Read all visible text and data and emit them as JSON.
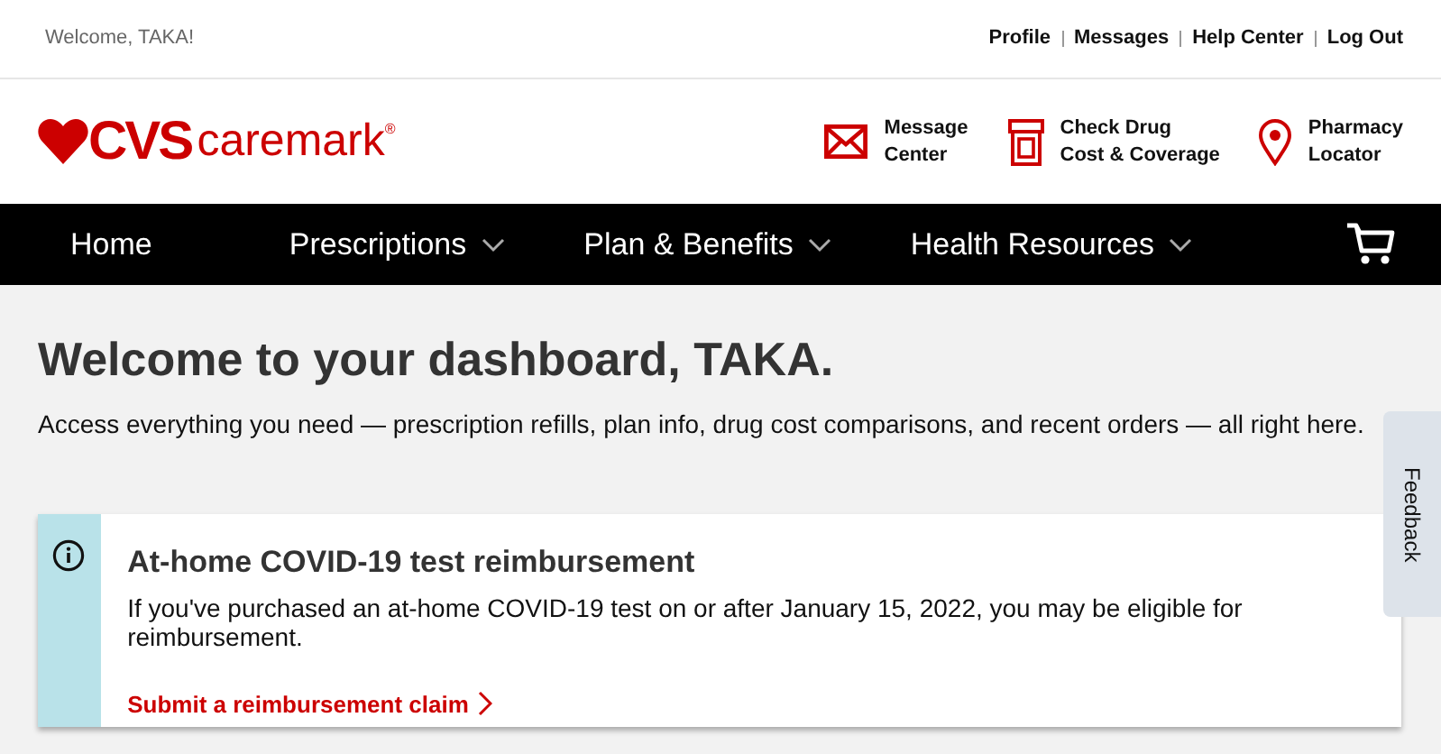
{
  "top_bar": {
    "greeting": "Welcome, TAKA!",
    "links": [
      "Profile",
      "Messages",
      "Help Center",
      "Log Out"
    ]
  },
  "logo": {
    "brand": "CVS",
    "product": "caremark",
    "mark": "®"
  },
  "quick_links": [
    {
      "kind": "mail",
      "lines": [
        "Message",
        "Center"
      ]
    },
    {
      "kind": "bottle",
      "lines": [
        "Check Drug",
        "Cost & Coverage"
      ]
    },
    {
      "kind": "pin",
      "lines": [
        "Pharmacy",
        "Locator"
      ]
    }
  ],
  "nav": [
    {
      "label": "Home",
      "dropdown": false
    },
    {
      "label": "Prescriptions",
      "dropdown": true
    },
    {
      "label": "Plan & Benefits",
      "dropdown": true
    },
    {
      "label": "Health Resources",
      "dropdown": true
    }
  ],
  "heading": "Welcome to your dashboard, TAKA.",
  "intro": "Access everything you need — prescription refills, plan info, drug cost comparisons, and recent orders — all right here.",
  "alert": {
    "title": "At-home COVID-19 test reimbursement",
    "body": "If you've purchased an at-home COVID-19 test on or after January 15, 2022, you may be eligible for reimbursement.",
    "link": "Submit a reimbursement claim"
  },
  "feedback_tab": "Feedback"
}
